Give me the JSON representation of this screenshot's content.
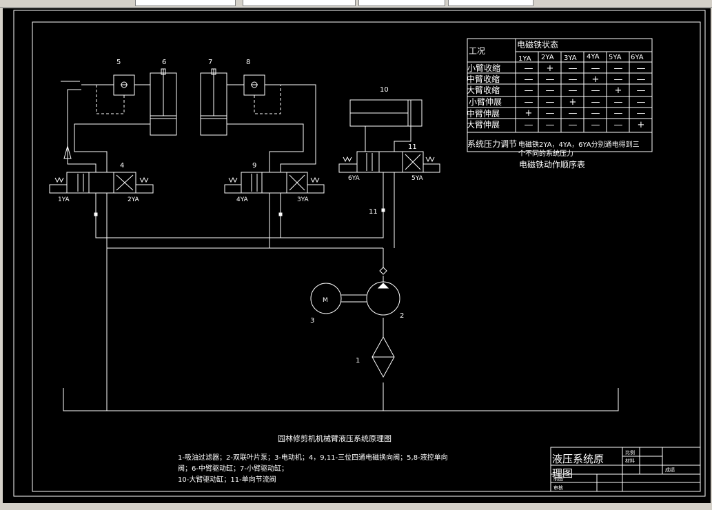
{
  "window": {
    "toolbar_fields": [
      "",
      "",
      "",
      ""
    ]
  },
  "colors": {
    "canvas": "#000000",
    "lines": "#ffffff",
    "frame": "#ffffff"
  },
  "diagram": {
    "component_numbers": {
      "n1": "1",
      "n2": "2",
      "n3": "3",
      "n4": "4",
      "n5": "5",
      "n6": "6",
      "n7": "7",
      "n8": "8",
      "n9": "9",
      "n10": "10",
      "n11a": "11",
      "n11b": "11"
    },
    "motor_label": "M",
    "solenoids": {
      "s1": "1YA",
      "s2": "2YA",
      "s3": "3YA",
      "s4": "4YA",
      "s5": "5YA",
      "s6": "6YA"
    },
    "title": "园林修剪机机械臂液压系统原理图",
    "legend_lines": [
      "1-吸油过滤器；2-双联叶片泵；3-电动机；4，9,11-三位四通电磁换向阀；5,8-液控单向",
      "阀；6-中臂驱动缸；7-小臂驱动缸；",
      "10-大臂驱动缸；11-单向节流阀"
    ]
  },
  "table": {
    "corner": "工况",
    "group_header": "电磁铁状态",
    "columns": [
      "1YA",
      "2YA",
      "3YA",
      "4YA",
      "5YA",
      "6YA"
    ],
    "rows": [
      {
        "label": "小臂收缩",
        "cells": [
          "—",
          "+",
          "—",
          "—",
          "—",
          "—"
        ]
      },
      {
        "label": "中臂收缩",
        "cells": [
          "—",
          "—",
          "—",
          "+",
          "—",
          "—"
        ]
      },
      {
        "label": "大臂收缩",
        "cells": [
          "—",
          "—",
          "—",
          "—",
          "+",
          "—"
        ]
      },
      {
        "label": "小臂伸展",
        "cells": [
          "—",
          "—",
          "+",
          "—",
          "—",
          "—"
        ]
      },
      {
        "label": "中臂伸展",
        "cells": [
          "+",
          "—",
          "—",
          "—",
          "—",
          "—"
        ]
      },
      {
        "label": "大臂伸展",
        "cells": [
          "—",
          "—",
          "—",
          "—",
          "—",
          "+"
        ]
      }
    ],
    "footer_label": "系统压力调节",
    "footer_note_1": "电磁铁2YA，4YA，6YA分别通电得到三",
    "footer_note_2": "个不同的系统压力",
    "caption": "电磁铁动作顺序表"
  },
  "title_block": {
    "name_1": "液压系统原",
    "name_2": "理图",
    "scale_label": "比例",
    "material_label": "材料",
    "grade_label": "成绩",
    "draw_label": "制图",
    "check_label": "审核"
  }
}
